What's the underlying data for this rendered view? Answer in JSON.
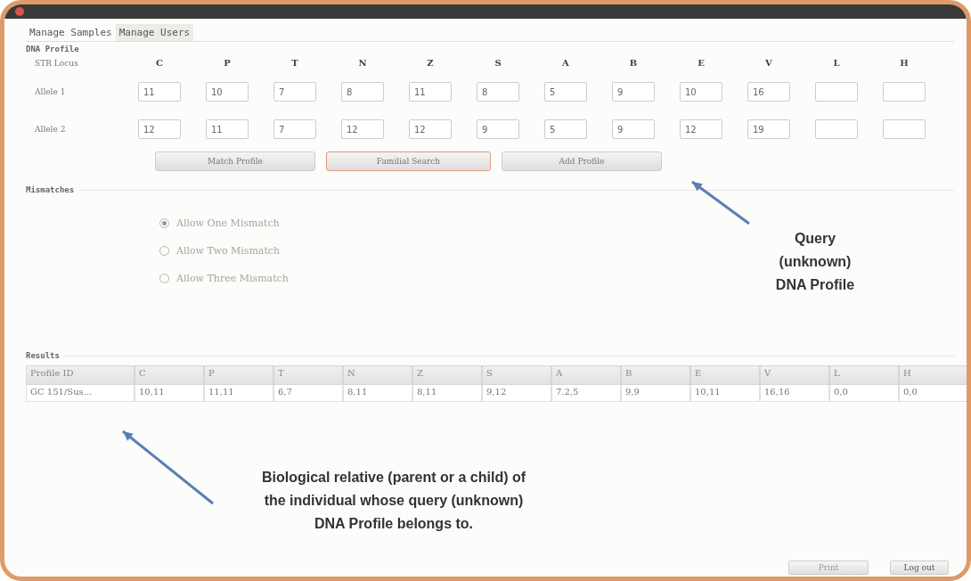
{
  "window": {
    "tabs": [
      {
        "label": "Manage Samples",
        "selected": true
      },
      {
        "label": "Manage Users",
        "selected": false
      }
    ]
  },
  "dna_profile": {
    "title": "DNA Profile",
    "locus_label": "STR Locus",
    "loci": [
      "C",
      "P",
      "T",
      "N",
      "Z",
      "S",
      "A",
      "B",
      "E",
      "V",
      "L",
      "H"
    ],
    "alleles": [
      {
        "label": "Allele 1",
        "values": [
          "11",
          "10",
          "7",
          "8",
          "11",
          "8",
          "5",
          "9",
          "10",
          "16"
        ]
      },
      {
        "label": "Allele 2",
        "values": [
          "12",
          "11",
          "7",
          "12",
          "12",
          "9",
          "5",
          "9",
          "12",
          "19"
        ]
      }
    ],
    "buttons": [
      {
        "label": "Match Profile",
        "focused": false
      },
      {
        "label": "Familial Search",
        "focused": true
      },
      {
        "label": "Add Profile",
        "focused": false
      }
    ]
  },
  "mismatches": {
    "title": "Mismatches",
    "disabled": true,
    "options": [
      {
        "label": "Allow One Mismatch",
        "selected": true
      },
      {
        "label": "Allow Two Mismatch",
        "selected": false
      },
      {
        "label": "Allow Three Mismatch",
        "selected": false
      }
    ]
  },
  "results": {
    "title": "Results",
    "columns": [
      "Profile ID",
      "C",
      "P",
      "T",
      "N",
      "Z",
      "S",
      "A",
      "B",
      "E",
      "V",
      "L",
      "H"
    ],
    "rows": [
      [
        "GC 151/Sus...",
        "10,11",
        "11,11",
        "6,7",
        "8,11",
        "8,11",
        "9,12",
        "7.2,5",
        "9,9",
        "10,11",
        "16,16",
        "0,0",
        "0,0"
      ]
    ]
  },
  "footer_buttons": [
    {
      "label": "Print",
      "disabled": true
    },
    {
      "label": "Log out",
      "disabled": false
    }
  ],
  "annotations": [
    {
      "kind": "query",
      "text": "Query (unknown) DNA Profile"
    },
    {
      "kind": "relative",
      "text": "Biological relative (parent or a child) of the individual whose query (unknown) DNA Profile belongs to."
    }
  ]
}
